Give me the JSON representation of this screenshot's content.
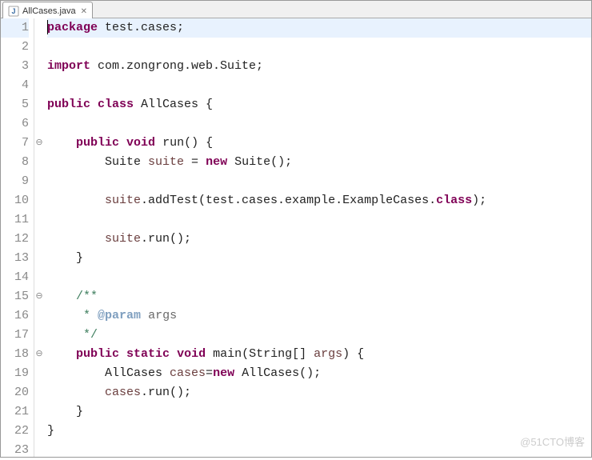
{
  "tab": {
    "filename": "AllCases.java",
    "close": "✕"
  },
  "code": {
    "lines": [
      {
        "n": "1",
        "fold": "",
        "hl": true,
        "tokens": [
          [
            "caret",
            ""
          ],
          [
            "kw",
            "package"
          ],
          [
            "txt",
            " test.cases;"
          ]
        ]
      },
      {
        "n": "2",
        "fold": "",
        "hl": false,
        "tokens": []
      },
      {
        "n": "3",
        "fold": "",
        "hl": false,
        "tokens": [
          [
            "kw",
            "import"
          ],
          [
            "txt",
            " com.zongrong.web.Suite;"
          ]
        ]
      },
      {
        "n": "4",
        "fold": "",
        "hl": false,
        "tokens": []
      },
      {
        "n": "5",
        "fold": "",
        "hl": false,
        "tokens": [
          [
            "kw",
            "public"
          ],
          [
            "txt",
            " "
          ],
          [
            "kw",
            "class"
          ],
          [
            "txt",
            " AllCases {"
          ]
        ]
      },
      {
        "n": "6",
        "fold": "",
        "hl": false,
        "tokens": []
      },
      {
        "n": "7",
        "fold": "⊖",
        "hl": false,
        "tokens": [
          [
            "txt",
            "    "
          ],
          [
            "kw",
            "public"
          ],
          [
            "txt",
            " "
          ],
          [
            "kw",
            "void"
          ],
          [
            "txt",
            " run() {"
          ]
        ]
      },
      {
        "n": "8",
        "fold": "",
        "hl": false,
        "tokens": [
          [
            "txt",
            "        Suite "
          ],
          [
            "var",
            "suite"
          ],
          [
            "txt",
            " = "
          ],
          [
            "kw",
            "new"
          ],
          [
            "txt",
            " Suite();"
          ]
        ]
      },
      {
        "n": "9",
        "fold": "",
        "hl": false,
        "tokens": []
      },
      {
        "n": "10",
        "fold": "",
        "hl": false,
        "tokens": [
          [
            "txt",
            "        "
          ],
          [
            "var",
            "suite"
          ],
          [
            "txt",
            ".addTest(test.cases.example.ExampleCases."
          ],
          [
            "kw",
            "class"
          ],
          [
            "txt",
            ");"
          ]
        ]
      },
      {
        "n": "11",
        "fold": "",
        "hl": false,
        "tokens": []
      },
      {
        "n": "12",
        "fold": "",
        "hl": false,
        "tokens": [
          [
            "txt",
            "        "
          ],
          [
            "var",
            "suite"
          ],
          [
            "txt",
            ".run();"
          ]
        ]
      },
      {
        "n": "13",
        "fold": "",
        "hl": false,
        "tokens": [
          [
            "txt",
            "    }"
          ]
        ]
      },
      {
        "n": "14",
        "fold": "",
        "hl": false,
        "tokens": []
      },
      {
        "n": "15",
        "fold": "⊖",
        "hl": false,
        "tokens": [
          [
            "txt",
            "    "
          ],
          [
            "comment",
            "/**"
          ]
        ]
      },
      {
        "n": "16",
        "fold": "",
        "hl": false,
        "tokens": [
          [
            "txt",
            "     "
          ],
          [
            "comment",
            "* "
          ],
          [
            "doctag",
            "@param"
          ],
          [
            "txt",
            " "
          ],
          [
            "param",
            "args"
          ]
        ]
      },
      {
        "n": "17",
        "fold": "",
        "hl": false,
        "tokens": [
          [
            "txt",
            "     "
          ],
          [
            "comment",
            "*/"
          ]
        ]
      },
      {
        "n": "18",
        "fold": "⊖",
        "hl": false,
        "tokens": [
          [
            "txt",
            "    "
          ],
          [
            "kw",
            "public"
          ],
          [
            "txt",
            " "
          ],
          [
            "kw",
            "static"
          ],
          [
            "txt",
            " "
          ],
          [
            "kw",
            "void"
          ],
          [
            "txt",
            " main(String[] "
          ],
          [
            "var",
            "args"
          ],
          [
            "txt",
            ") {"
          ]
        ]
      },
      {
        "n": "19",
        "fold": "",
        "hl": false,
        "tokens": [
          [
            "txt",
            "        AllCases "
          ],
          [
            "var",
            "cases"
          ],
          [
            "txt",
            "="
          ],
          [
            "kw",
            "new"
          ],
          [
            "txt",
            " AllCases();"
          ]
        ]
      },
      {
        "n": "20",
        "fold": "",
        "hl": false,
        "tokens": [
          [
            "txt",
            "        "
          ],
          [
            "var",
            "cases"
          ],
          [
            "txt",
            ".run();"
          ]
        ]
      },
      {
        "n": "21",
        "fold": "",
        "hl": false,
        "tokens": [
          [
            "txt",
            "    }"
          ]
        ]
      },
      {
        "n": "22",
        "fold": "",
        "hl": false,
        "tokens": [
          [
            "txt",
            "}"
          ]
        ]
      },
      {
        "n": "23",
        "fold": "",
        "hl": false,
        "tokens": []
      }
    ]
  },
  "watermark": "@51CTO博客"
}
